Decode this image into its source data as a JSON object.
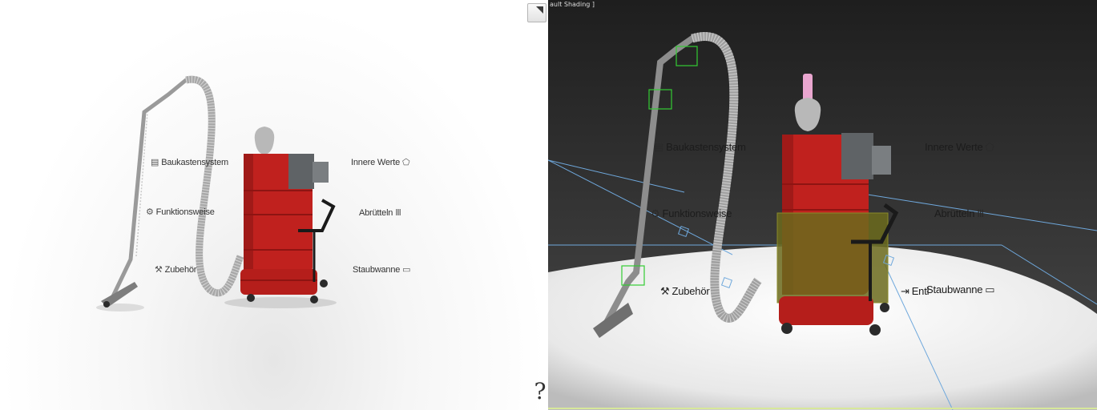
{
  "left_viewport": {
    "labels": {
      "baukastensystem": {
        "text": "Baukastensystem",
        "icon": "building-blocks-icon",
        "glyph": "▤"
      },
      "funktionsweise": {
        "text": "Funktionsweise",
        "icon": "gears-icon",
        "glyph": "⚙"
      },
      "zubehoer": {
        "text": "Zubehör",
        "icon": "tools-icon",
        "glyph": "⚒"
      },
      "innere_werte": {
        "text": "Innere Werte",
        "icon": "pentagon-icon",
        "glyph": "⬠"
      },
      "abruetteln": {
        "text": "Abrütteln",
        "icon": "shaker-icon",
        "glyph": "Ⅲ"
      },
      "staubwanne": {
        "text": "Staubwanne",
        "icon": "tray-icon",
        "glyph": "▭"
      }
    }
  },
  "right_viewport": {
    "title": "ault Shading ]",
    "labels": {
      "baukastensystem": {
        "text": "Baukastensystem",
        "icon": "building-blocks-icon",
        "glyph": "▤"
      },
      "funktionsweise": {
        "text": "Funktionsweise",
        "icon": "gears-icon",
        "glyph": "⚙"
      },
      "zubehoer": {
        "text": "Zubehör",
        "icon": "tools-icon",
        "glyph": "⚒"
      },
      "innere_werte": {
        "text": "Innere Werte",
        "icon": "pentagon-icon",
        "glyph": "⬠"
      },
      "abruetteln": {
        "text": "Abrütteln",
        "icon": "shaker-icon",
        "glyph": "Ⅲ"
      },
      "staubwanne": {
        "text": "Staubwanne",
        "icon": "tray-icon",
        "glyph": "▭"
      },
      "entleeren": {
        "text": "Entl",
        "icon": "empty-icon",
        "glyph": "⇥"
      }
    }
  },
  "controls": {
    "help_glyph": "?"
  },
  "colors": {
    "vacuum_body": "#c0211e",
    "vacuum_body_shade": "#8e1412",
    "motor_gray": "#5f6366",
    "hose_gray": "#a8a8a8",
    "handle_black": "#1a1a1a",
    "wire_green": "#33cc33",
    "wire_blue": "#6fa8dc",
    "overlay_olive": "#6b6a1c",
    "pink_part": "#e9a6cf"
  }
}
